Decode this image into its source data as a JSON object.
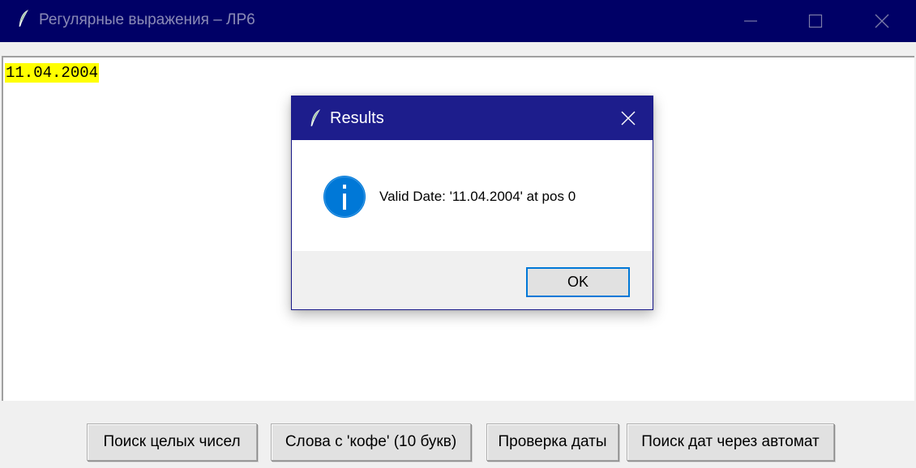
{
  "window": {
    "title": "Регулярные выражения – ЛР6"
  },
  "editor": {
    "content_line": "11.04.2004",
    "highlight_color": "#ffff00"
  },
  "buttons": {
    "find_integers": "Поиск целых чисел",
    "coffee_words": "Слова с 'кофе' (10 букв)",
    "check_date": "Проверка даты",
    "find_dates_automaton": "Поиск дат через автомат"
  },
  "dialog": {
    "title": "Results",
    "message": "Valid Date: '11.04.2004' at pos 0",
    "ok_label": "OK",
    "icon": "info-icon"
  },
  "colors": {
    "titlebar": "#000066",
    "dialog_titlebar": "#1d1d8c",
    "info_blue": "#0078d7"
  }
}
